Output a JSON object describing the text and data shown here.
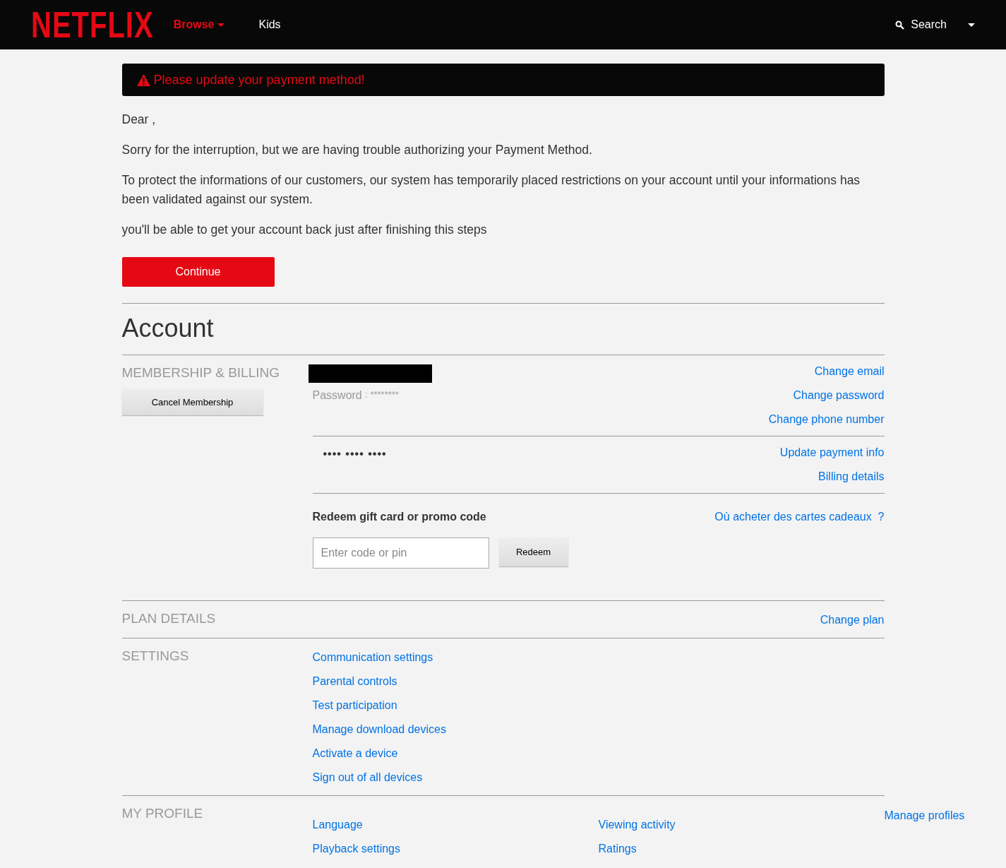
{
  "header": {
    "logo": "NETFLIX",
    "nav": [
      {
        "label": "Browse",
        "selected": true,
        "dropdown": true
      },
      {
        "label": "Kids",
        "selected": false,
        "dropdown": false
      }
    ],
    "search": "Search"
  },
  "alert": {
    "text": "Please update your payment method!"
  },
  "message": {
    "paragraphs": [
      "Dear ,",
      "Sorry for the interruption, but we are having trouble authorizing your Payment Method.",
      "To protect the informations of our customers, our system has temporarily placed restrictions on your account until your informations has been validated against our system.",
      "you'll be able to get your account back just after finishing this steps"
    ],
    "button": "Continue"
  },
  "account": {
    "title": "Account",
    "membership": {
      "heading": "MEMBERSHIP & BILLING",
      "cancel_button": "Cancel Membership",
      "password_label": "Password",
      "password_value": ": ********",
      "account_links": [
        "Change email",
        "Change password",
        "Change phone number"
      ],
      "card_mask": "•••• •••• ••••",
      "payment_links": [
        "Update payment info",
        "Billing details"
      ],
      "redeem": {
        "label": "Redeem gift card or promo code",
        "help_link": "Où acheter des cartes cadeaux  ?",
        "placeholder": "Enter code or pin",
        "button": "Redeem"
      }
    },
    "plan": {
      "heading": "PLAN DETAILS",
      "link": "Change plan"
    },
    "settings": {
      "heading": "SETTINGS",
      "links": [
        "Communication settings",
        "Parental controls",
        "Test participation",
        "Manage download devices",
        "Activate a device",
        "Sign out of all devices"
      ]
    },
    "profile": {
      "heading": "MY PROFILE",
      "column_1": [
        "Language",
        "Playback settings"
      ],
      "column_2": [
        "Viewing activity",
        "Ratings"
      ],
      "column_3": [
        "Manage profiles"
      ]
    }
  }
}
